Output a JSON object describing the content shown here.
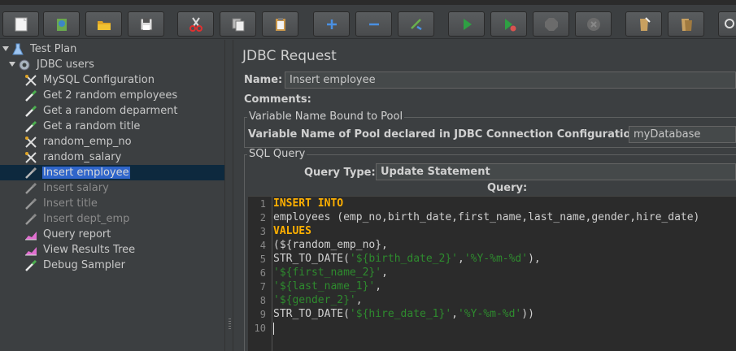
{
  "toolbar": {
    "buttons": [
      "new-icon",
      "templates-icon",
      "open-icon",
      "save-icon",
      "cut-icon",
      "copy-icon",
      "paste-icon",
      "expand-icon",
      "collapse-icon",
      "toggle-icon",
      "start-icon",
      "start-no-pause-icon",
      "stop-icon",
      "shutdown-icon",
      "clear-icon",
      "clear-all-icon"
    ]
  },
  "tree": {
    "nodes": [
      {
        "label": "Test Plan",
        "icon": "flask-icon"
      },
      {
        "label": "JDBC users",
        "icon": "gear-icon"
      },
      {
        "label": "MySQL Configuration",
        "icon": "wrench-icon"
      },
      {
        "label": "Get 2 random employees",
        "icon": "pipette-icon"
      },
      {
        "label": "Get a random deparment",
        "icon": "pipette-icon"
      },
      {
        "label": "Get a random title",
        "icon": "pipette-icon"
      },
      {
        "label": "random_emp_no",
        "icon": "wrench-icon"
      },
      {
        "label": "random_salary",
        "icon": "wrench-icon"
      },
      {
        "label": "Insert employee",
        "icon": "pipette-icon"
      },
      {
        "label": "Insert salary",
        "icon": "pipette-icon"
      },
      {
        "label": "Insert title",
        "icon": "pipette-icon"
      },
      {
        "label": "Insert dept_emp",
        "icon": "pipette-icon"
      },
      {
        "label": "Query report",
        "icon": "chart-icon"
      },
      {
        "label": "View Results Tree",
        "icon": "chart-icon"
      },
      {
        "label": "Debug Sampler",
        "icon": "pipette-icon"
      }
    ]
  },
  "panel": {
    "title": "JDBC Request",
    "name_label": "Name:",
    "name_value": "Insert employee",
    "comments_label": "Comments:",
    "pool_group_title": "Variable Name Bound to Pool",
    "pool_label": "Variable Name of Pool declared in JDBC Connection Configuration:",
    "pool_value": "myDatabase",
    "sql_group_title": "SQL Query",
    "query_type_label": "Query Type:",
    "query_type_value": "Update Statement",
    "query_label": "Query:"
  },
  "editor": {
    "line_numbers": [
      "1",
      "2",
      "3",
      "4",
      "5",
      "6",
      "7",
      "8",
      "9",
      "10"
    ],
    "lines": [
      [
        {
          "t": "INSERT INTO",
          "c": "kw"
        }
      ],
      [
        {
          "t": "employees (emp_no,birth_date,first_name,last_name,gender,hire_date)",
          "c": "plain"
        }
      ],
      [
        {
          "t": "VALUES",
          "c": "kw"
        }
      ],
      [
        {
          "t": "(${random_emp_no},",
          "c": "plain"
        }
      ],
      [
        {
          "t": "STR_TO_DATE(",
          "c": "plain"
        },
        {
          "t": "'${birth_date_2}'",
          "c": "str"
        },
        {
          "t": ",",
          "c": "plain"
        },
        {
          "t": "'%Y-%m-%d'",
          "c": "str"
        },
        {
          "t": "),",
          "c": "plain"
        }
      ],
      [
        {
          "t": "'${first_name_2}'",
          "c": "str"
        },
        {
          "t": ",",
          "c": "plain"
        }
      ],
      [
        {
          "t": "'${last_name_1}'",
          "c": "str"
        },
        {
          "t": ",",
          "c": "plain"
        }
      ],
      [
        {
          "t": "'${gender_2}'",
          "c": "str"
        },
        {
          "t": ",",
          "c": "plain"
        }
      ],
      [
        {
          "t": "STR_TO_DATE(",
          "c": "plain"
        },
        {
          "t": "'${hire_date_1}'",
          "c": "str"
        },
        {
          "t": ",",
          "c": "plain"
        },
        {
          "t": "'%Y-%m-%d'",
          "c": "str"
        },
        {
          "t": "))",
          "c": "plain"
        }
      ],
      []
    ]
  },
  "colors": {
    "keyword": "#ffb000",
    "string": "#2e8b2e",
    "selection": "#2f65ca"
  }
}
